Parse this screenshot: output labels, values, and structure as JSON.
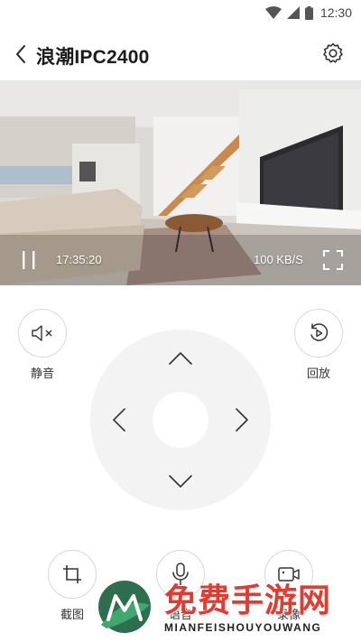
{
  "status_bar": {
    "time": "12:30"
  },
  "header": {
    "title": "浪潮IPC2400"
  },
  "video": {
    "timestamp": "17:35:20",
    "bitrate": "100 KB/S"
  },
  "controls": {
    "mute_label": "静音",
    "playback_label": "回放",
    "screenshot_label": "截图",
    "voice_label": "语音",
    "record_label": "录像"
  },
  "watermark": {
    "title": "免费手游网",
    "subtitle": "MIANFEISHOUYOUWANG"
  },
  "colors": {
    "accent": "#e63a2e",
    "ring": "#d8d8d8",
    "dpad": "#f3f3f3"
  }
}
